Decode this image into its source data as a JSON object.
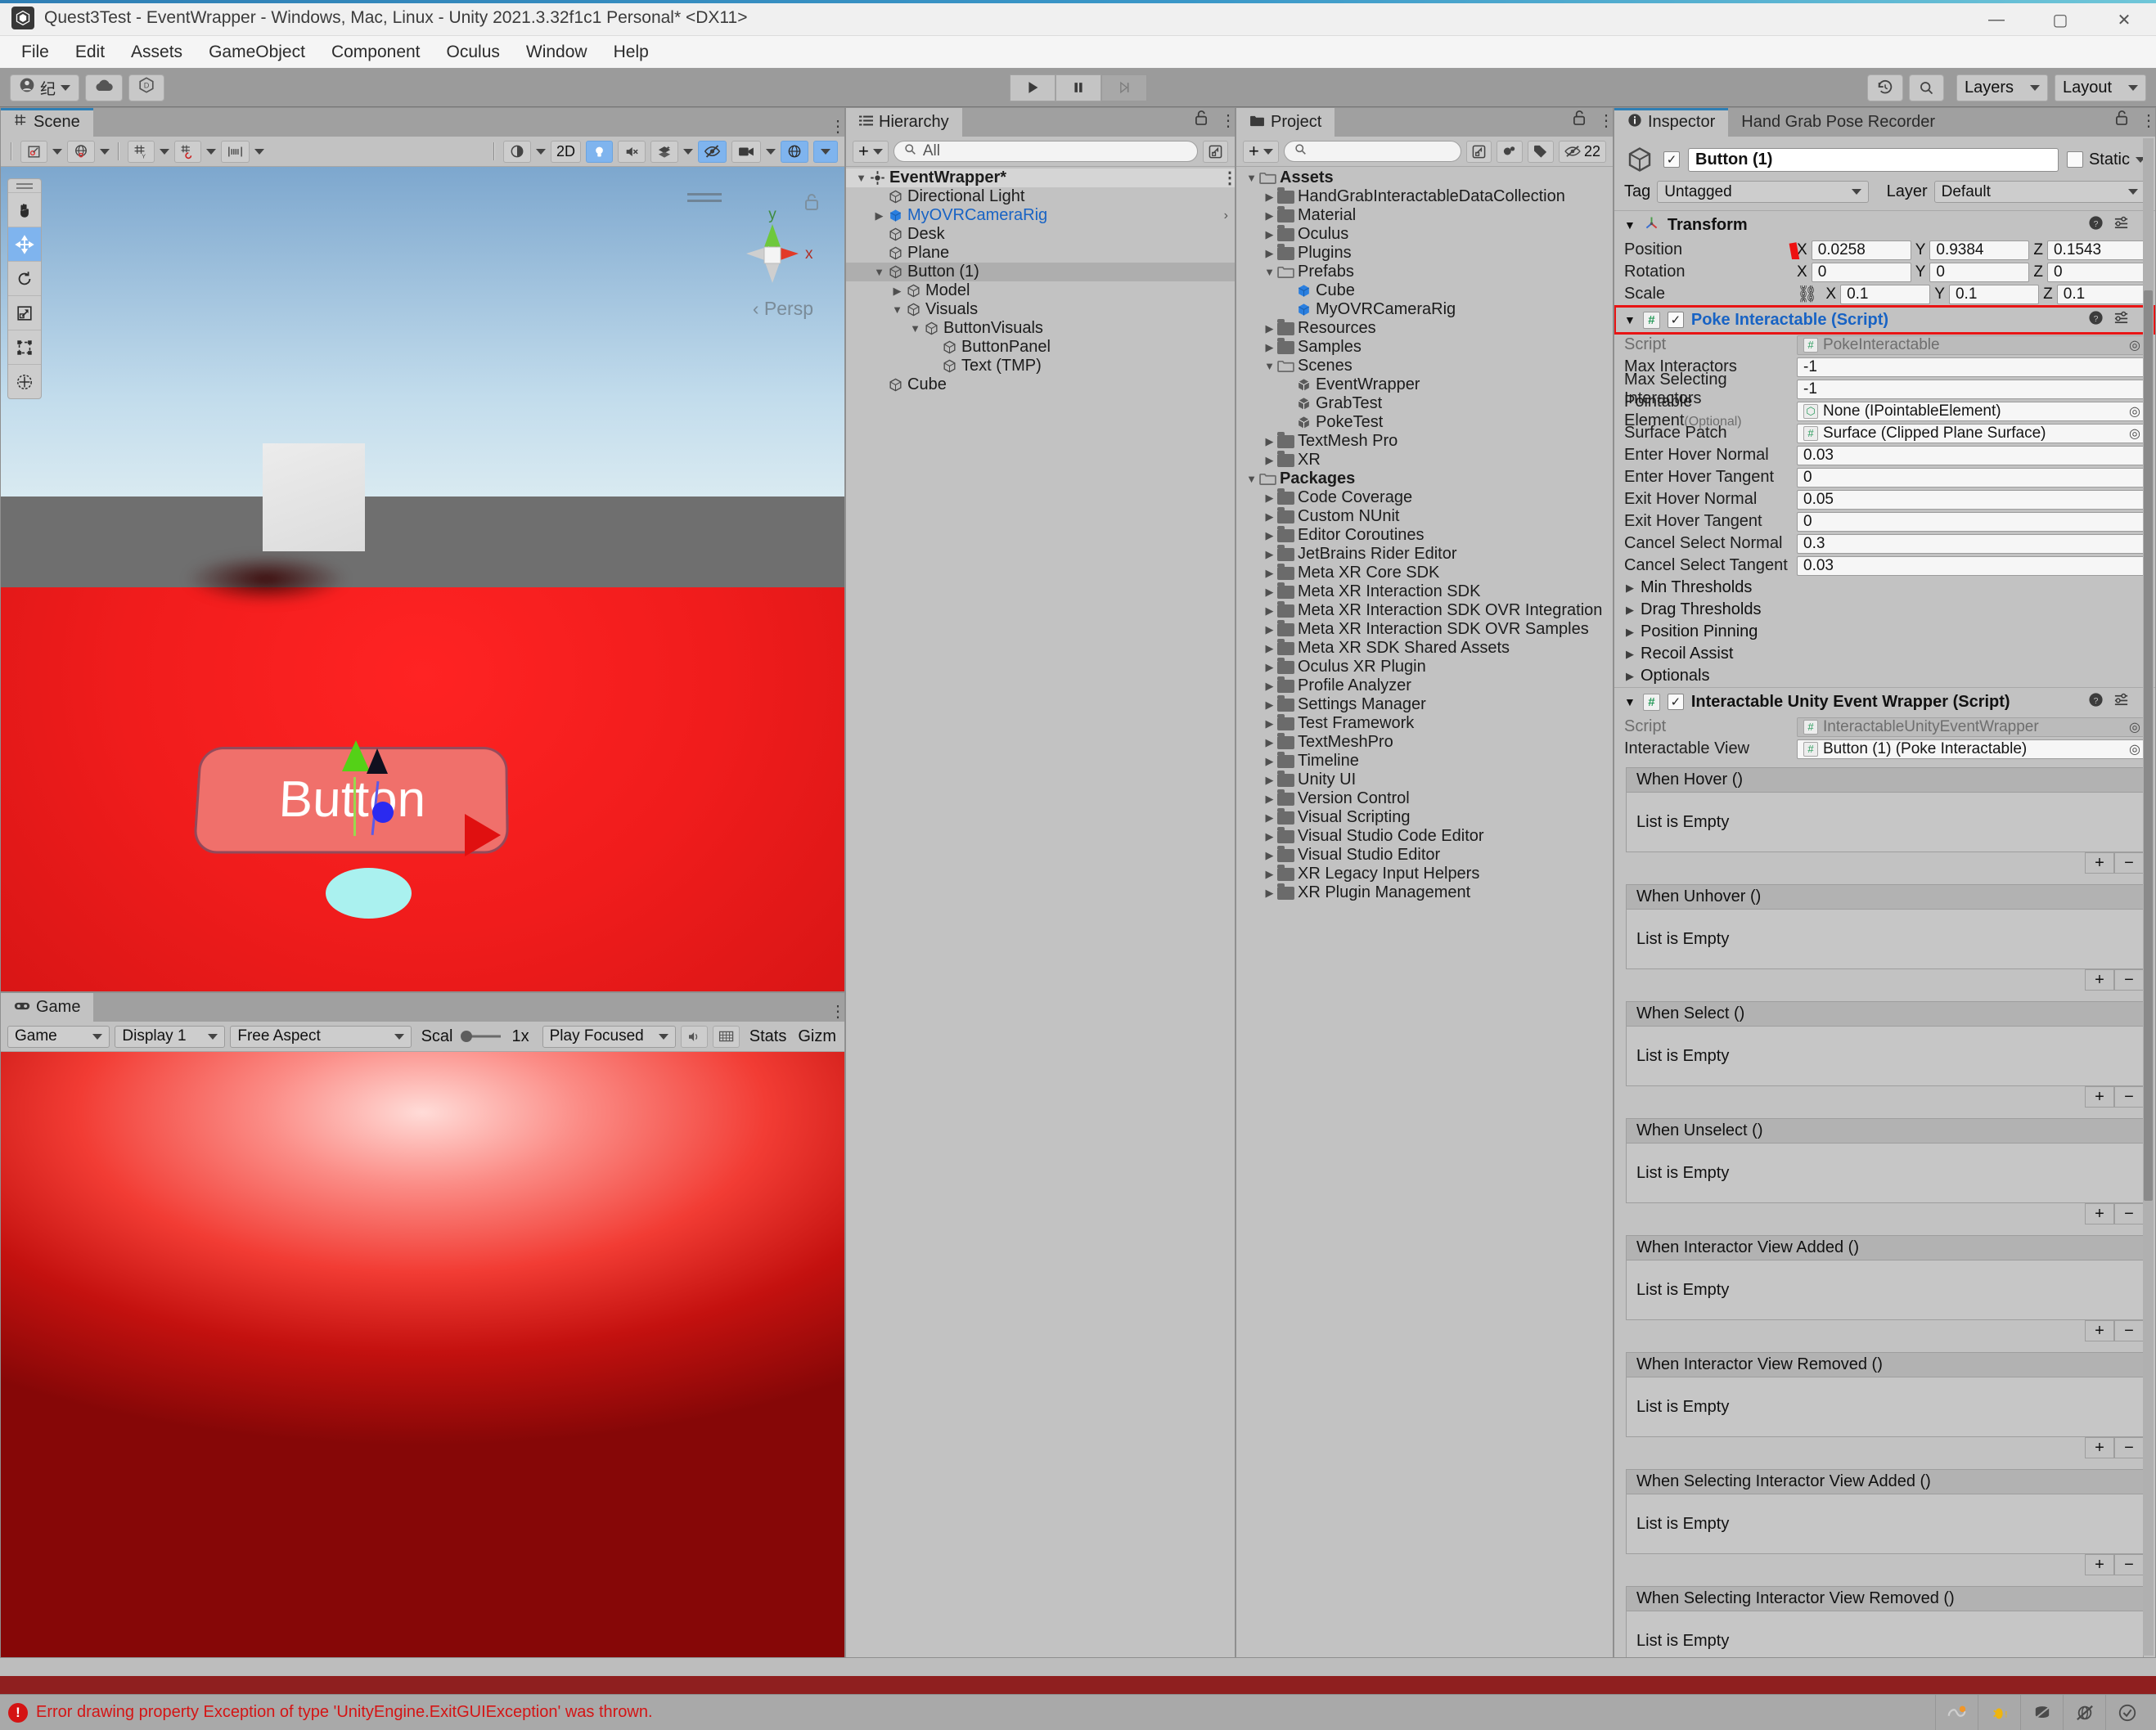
{
  "window": {
    "title": "Quest3Test - EventWrapper - Windows, Mac, Linux - Unity 2021.3.32f1c1 Personal* <DX11>",
    "minimize": "—",
    "maximize": "▢",
    "close": "✕"
  },
  "menubar": {
    "items": [
      "File",
      "Edit",
      "Assets",
      "GameObject",
      "Component",
      "Oculus",
      "Window",
      "Help"
    ]
  },
  "toolbar": {
    "account_label": "纪",
    "cloud_label": "cloud-icon",
    "services_label": "D",
    "play": "▶",
    "pause": "❚❚",
    "step": "▶|",
    "undo_history": "undo-history-icon",
    "search": "search-icon",
    "layers": "Layers",
    "layout": "Layout"
  },
  "scene": {
    "tab": "Scene",
    "tools": [
      "pivot-rotate-icon",
      "global-local-icon",
      "grid-snap-icon",
      "snap-increment-icon",
      "grid-visibility-icon"
    ],
    "right_tools": [
      "shading-mode-icon",
      "2D",
      "lighting-icon",
      "audio-icon",
      "fx-icon",
      "hidden-objects-icon",
      "camera-icon",
      "gizmos-icon"
    ],
    "shading_2d": "2D",
    "transform_tools": [
      "hand-tool",
      "move-tool",
      "rotate-tool",
      "scale-tool",
      "rect-tool",
      "transform-tool"
    ],
    "gizmo": {
      "x_axis": "x",
      "y_axis": "y",
      "mode": "Persp"
    },
    "button_label": "Button"
  },
  "game": {
    "tab": "Game",
    "target": "Game",
    "display": "Display 1",
    "aspect": "Free Aspect",
    "scale_label": "Scal",
    "scale_value": "1x",
    "play_mode": "Play Focused",
    "mute_icon": "mute-audio-icon",
    "vsync_icon": "vsync-icon",
    "stats": "Stats",
    "gizmos": "Gizm"
  },
  "hierarchy": {
    "tab": "Hierarchy",
    "add_label": "+",
    "search_placeholder": "All",
    "items": [
      {
        "label": "EventWrapper*",
        "depth": 0,
        "icon": "scene-icon",
        "twisty": "down",
        "bold": true,
        "scene": true,
        "kebab": true
      },
      {
        "label": "Directional Light",
        "depth": 1,
        "icon": "gameobject-icon",
        "twisty": ""
      },
      {
        "label": "MyOVRCameraRig",
        "depth": 1,
        "icon": "prefab-icon",
        "twisty": "right",
        "blue": true,
        "chevron": true
      },
      {
        "label": "Desk",
        "depth": 1,
        "icon": "gameobject-icon",
        "twisty": ""
      },
      {
        "label": "Plane",
        "depth": 1,
        "icon": "gameobject-icon",
        "twisty": ""
      },
      {
        "label": "Button (1)",
        "depth": 1,
        "icon": "gameobject-icon",
        "twisty": "down",
        "selected": true
      },
      {
        "label": "Model",
        "depth": 2,
        "icon": "gameobject-icon",
        "twisty": "right"
      },
      {
        "label": "Visuals",
        "depth": 2,
        "icon": "gameobject-icon",
        "twisty": "down"
      },
      {
        "label": "ButtonVisuals",
        "depth": 3,
        "icon": "gameobject-icon",
        "twisty": "down"
      },
      {
        "label": "ButtonPanel",
        "depth": 4,
        "icon": "gameobject-icon",
        "twisty": ""
      },
      {
        "label": "Text (TMP)",
        "depth": 4,
        "icon": "gameobject-icon",
        "twisty": ""
      },
      {
        "label": "Cube",
        "depth": 1,
        "icon": "gameobject-icon",
        "twisty": ""
      }
    ]
  },
  "project": {
    "tab": "Project",
    "add_label": "+",
    "search_placeholder": "",
    "hidden_count": "22",
    "items": [
      {
        "label": "Assets",
        "depth": 0,
        "icon": "folder-open",
        "twisty": "down",
        "bold": true
      },
      {
        "label": "HandGrabInteractableDataCollection",
        "depth": 1,
        "icon": "folder",
        "twisty": "right"
      },
      {
        "label": "Material",
        "depth": 1,
        "icon": "folder",
        "twisty": "right"
      },
      {
        "label": "Oculus",
        "depth": 1,
        "icon": "folder",
        "twisty": "right"
      },
      {
        "label": "Plugins",
        "depth": 1,
        "icon": "folder",
        "twisty": "right"
      },
      {
        "label": "Prefabs",
        "depth": 1,
        "icon": "folder-open",
        "twisty": "down"
      },
      {
        "label": "Cube",
        "depth": 2,
        "icon": "prefab-icon",
        "twisty": ""
      },
      {
        "label": "MyOVRCameraRig",
        "depth": 2,
        "icon": "prefab-icon",
        "twisty": ""
      },
      {
        "label": "Resources",
        "depth": 1,
        "icon": "folder",
        "twisty": "right"
      },
      {
        "label": "Samples",
        "depth": 1,
        "icon": "folder",
        "twisty": "right"
      },
      {
        "label": "Scenes",
        "depth": 1,
        "icon": "folder-open",
        "twisty": "down"
      },
      {
        "label": "EventWrapper",
        "depth": 2,
        "icon": "scene-asset-icon",
        "twisty": ""
      },
      {
        "label": "GrabTest",
        "depth": 2,
        "icon": "scene-asset-icon",
        "twisty": ""
      },
      {
        "label": "PokeTest",
        "depth": 2,
        "icon": "scene-asset-icon",
        "twisty": ""
      },
      {
        "label": "TextMesh Pro",
        "depth": 1,
        "icon": "folder",
        "twisty": "right"
      },
      {
        "label": "XR",
        "depth": 1,
        "icon": "folder",
        "twisty": "right"
      },
      {
        "label": "Packages",
        "depth": 0,
        "icon": "folder-open",
        "twisty": "down",
        "bold": true
      },
      {
        "label": "Code Coverage",
        "depth": 1,
        "icon": "folder",
        "twisty": "right"
      },
      {
        "label": "Custom NUnit",
        "depth": 1,
        "icon": "folder",
        "twisty": "right"
      },
      {
        "label": "Editor Coroutines",
        "depth": 1,
        "icon": "folder",
        "twisty": "right"
      },
      {
        "label": "JetBrains Rider Editor",
        "depth": 1,
        "icon": "folder",
        "twisty": "right"
      },
      {
        "label": "Meta XR Core SDK",
        "depth": 1,
        "icon": "folder",
        "twisty": "right"
      },
      {
        "label": "Meta XR Interaction SDK",
        "depth": 1,
        "icon": "folder",
        "twisty": "right"
      },
      {
        "label": "Meta XR Interaction SDK OVR Integration",
        "depth": 1,
        "icon": "folder",
        "twisty": "right"
      },
      {
        "label": "Meta XR Interaction SDK OVR Samples",
        "depth": 1,
        "icon": "folder",
        "twisty": "right"
      },
      {
        "label": "Meta XR SDK Shared Assets",
        "depth": 1,
        "icon": "folder",
        "twisty": "right"
      },
      {
        "label": "Oculus XR Plugin",
        "depth": 1,
        "icon": "folder",
        "twisty": "right"
      },
      {
        "label": "Profile Analyzer",
        "depth": 1,
        "icon": "folder",
        "twisty": "right"
      },
      {
        "label": "Settings Manager",
        "depth": 1,
        "icon": "folder",
        "twisty": "right"
      },
      {
        "label": "Test Framework",
        "depth": 1,
        "icon": "folder",
        "twisty": "right"
      },
      {
        "label": "TextMeshPro",
        "depth": 1,
        "icon": "folder",
        "twisty": "right"
      },
      {
        "label": "Timeline",
        "depth": 1,
        "icon": "folder",
        "twisty": "right"
      },
      {
        "label": "Unity UI",
        "depth": 1,
        "icon": "folder",
        "twisty": "right"
      },
      {
        "label": "Version Control",
        "depth": 1,
        "icon": "folder",
        "twisty": "right"
      },
      {
        "label": "Visual Scripting",
        "depth": 1,
        "icon": "folder",
        "twisty": "right"
      },
      {
        "label": "Visual Studio Code Editor",
        "depth": 1,
        "icon": "folder",
        "twisty": "right"
      },
      {
        "label": "Visual Studio Editor",
        "depth": 1,
        "icon": "folder",
        "twisty": "right"
      },
      {
        "label": "XR Legacy Input Helpers",
        "depth": 1,
        "icon": "folder",
        "twisty": "right"
      },
      {
        "label": "XR Plugin Management",
        "depth": 1,
        "icon": "folder",
        "twisty": "right"
      }
    ]
  },
  "inspector": {
    "tab": "Inspector",
    "tab2": "Hand Grab Pose Recorder",
    "object_name": "Button (1)",
    "enabled": true,
    "static_label": "Static",
    "tag_label": "Tag",
    "tag_value": "Untagged",
    "layer_label": "Layer",
    "layer_value": "Default",
    "transform": {
      "title": "Transform",
      "rows": [
        {
          "label": "Position",
          "x": "0.0258",
          "y": "0.9384",
          "z": "0.1543",
          "link": false
        },
        {
          "label": "Rotation",
          "x": "0",
          "y": "0",
          "z": "0",
          "link": false
        },
        {
          "label": "Scale",
          "x": "0.1",
          "y": "0.1",
          "z": "0.1",
          "link": true
        }
      ],
      "axes": [
        "X",
        "Y",
        "Z"
      ]
    },
    "poke": {
      "title": "Poke Interactable (Script)",
      "highlighted": true,
      "props": [
        {
          "label": "Script",
          "value": "PokeInteractable",
          "dim": true,
          "objref": true,
          "icon": "script-icon"
        },
        {
          "label": "Max Interactors",
          "value": "-1"
        },
        {
          "label": "Max Selecting Interactors",
          "value": "-1"
        },
        {
          "label": "Pointable Element",
          "optional": "(Optional)",
          "value": "None (IPointableElement)",
          "objref": true,
          "icon": "gameobject-icon"
        },
        {
          "label": "Surface Patch",
          "value": "Surface (Clipped Plane Surface)",
          "objref": true,
          "icon": "script-icon"
        },
        {
          "label": "Enter Hover Normal",
          "value": "0.03"
        },
        {
          "label": "Enter Hover Tangent",
          "value": "0"
        },
        {
          "label": "Exit Hover Normal",
          "value": "0.05"
        },
        {
          "label": "Exit Hover Tangent",
          "value": "0"
        },
        {
          "label": "Cancel Select Normal",
          "value": "0.3"
        },
        {
          "label": "Cancel Select Tangent",
          "value": "0.03"
        }
      ],
      "foldouts": [
        "Min Thresholds",
        "Drag Thresholds",
        "Position Pinning",
        "Recoil Assist",
        "Optionals"
      ]
    },
    "wrapper": {
      "title": "Interactable Unity Event Wrapper (Script)",
      "script_label": "Script",
      "script_value": "InteractableUnityEventWrapper",
      "view_label": "Interactable View",
      "view_value": "Button (1) (Poke Interactable)",
      "empty_text": "List is Empty",
      "add_label": "+",
      "remove_label": "−",
      "events": [
        "When Hover ()",
        "When Unhover ()",
        "When Select ()",
        "When Unselect ()",
        "When Interactor View Added ()",
        "When Interactor View Removed ()",
        "When Selecting Interactor View Added ()",
        "When Selecting Interactor View Removed ()"
      ]
    }
  },
  "statusbar": {
    "error_text": "Error drawing property Exception of type 'UnityEngine.ExitGUIException' was thrown.",
    "error_icon": "!",
    "icons": [
      "collab-icon",
      "bug-icon",
      "layers-stack-icon",
      "preview-pack-icon",
      "check-circle-icon"
    ]
  },
  "colors": {
    "accent_blue": "#2f7fb5",
    "selection_blue": "#7fb4ee",
    "highlight_red": "#e81414",
    "link_blue": "#1863c4",
    "error_red": "#d41414"
  }
}
